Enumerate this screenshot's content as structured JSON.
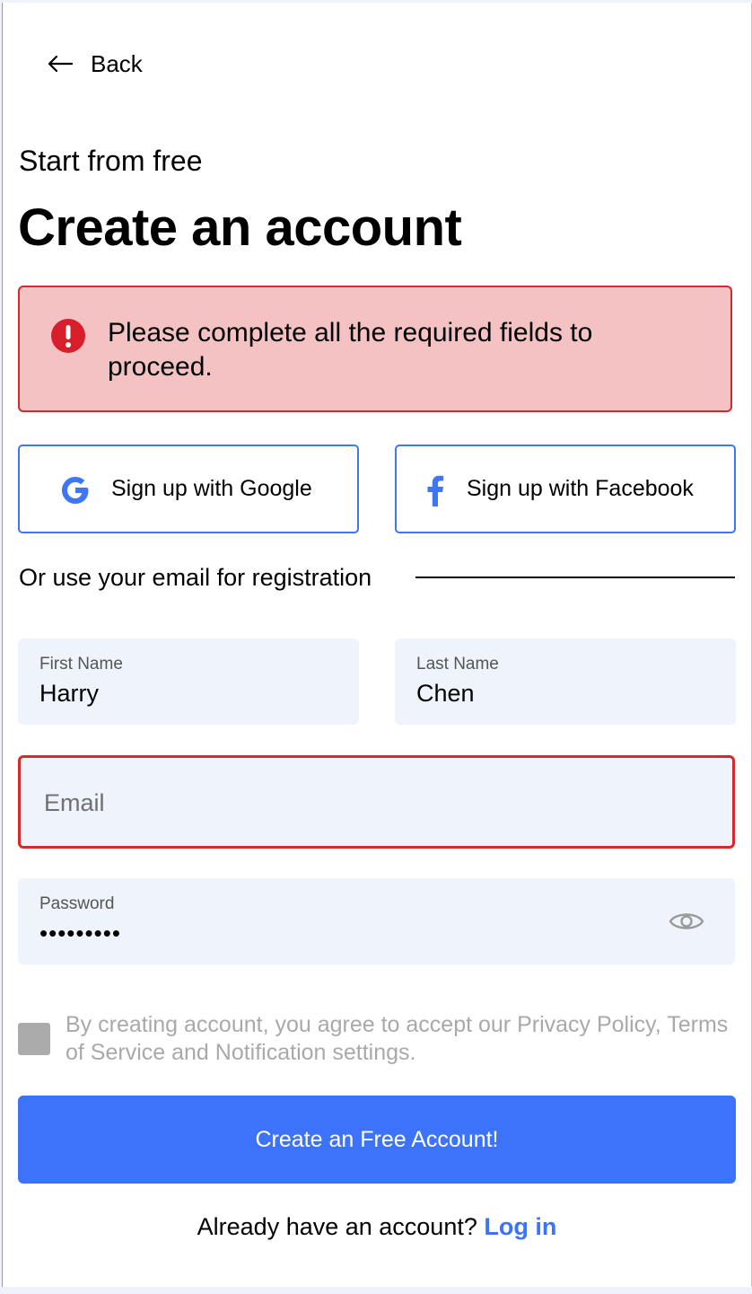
{
  "nav": {
    "back_label": "Back",
    "back_icon": "arrow-left-icon"
  },
  "header": {
    "subtitle": "Start from free",
    "title": "Create an account"
  },
  "alert": {
    "icon": "error-icon",
    "message": "Please complete all the required fields to proceed.",
    "color": "#d42a2a",
    "background": "#f4c2c3"
  },
  "social": {
    "google_label": "Sign up with Google",
    "google_icon": "google-icon",
    "facebook_label": "Sign up with Facebook",
    "facebook_icon": "facebook-icon"
  },
  "divider": {
    "text": "Or use your email for registration"
  },
  "form": {
    "first_name": {
      "label": "First Name",
      "value": "Harry"
    },
    "last_name": {
      "label": "Last Name",
      "value": "Chen"
    },
    "email": {
      "placeholder": "Email",
      "value": ""
    },
    "password": {
      "label": "Password",
      "value": "•••••••••",
      "toggle_icon": "eye-icon"
    }
  },
  "terms": {
    "text": "By creating account, you agree to accept our Privacy Policy, Terms of Service and Notification settings.",
    "checked": false
  },
  "cta": {
    "label": "Create an Free Account!",
    "color": "#3d73fb"
  },
  "footer": {
    "prompt": "Already have an account?",
    "login_label": "Log in"
  }
}
